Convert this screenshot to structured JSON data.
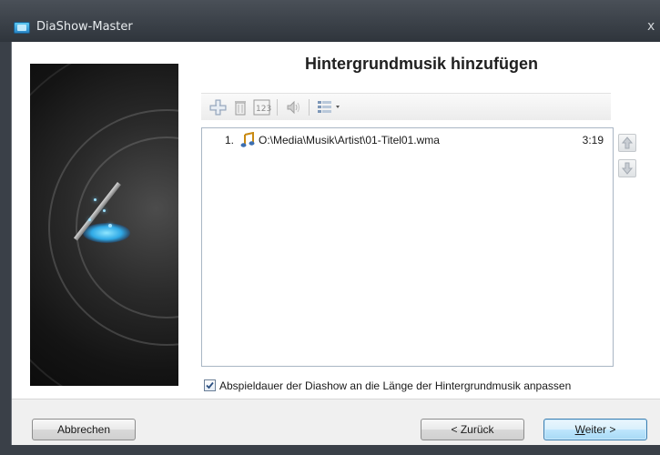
{
  "window": {
    "title": "DiaShow-Master",
    "close_glyph": "x"
  },
  "page": {
    "heading": "Hintergrundmusik hinzufügen"
  },
  "toolbar": {
    "items": [
      {
        "icon": "add-icon"
      },
      {
        "icon": "delete-icon"
      },
      {
        "icon": "number-order-icon"
      },
      {
        "icon": "volume-icon"
      },
      {
        "icon": "list-view-icon"
      }
    ]
  },
  "playlist": {
    "items": [
      {
        "number": "1.",
        "icon": "music-note-icon",
        "path": "O:\\Media\\Musik\\Artist\\01-Titel01.wma",
        "duration": "3:19"
      }
    ]
  },
  "side_buttons": {
    "up_icon": "move-up-icon",
    "down_icon": "move-down-icon"
  },
  "options": {
    "fit_duration_label": "Abspieldauer der Diashow an die Länge der Hintergrundmusik anpassen",
    "fit_duration_checked": true
  },
  "footer": {
    "cancel_label": "Abbrechen",
    "back_label": "< Zurück",
    "next_label_accel": "W",
    "next_label_rest": "eiter >"
  },
  "colors": {
    "accent": "#3c7fb1",
    "titlebar": "#2f353c",
    "list_border": "#a9b6c4"
  }
}
